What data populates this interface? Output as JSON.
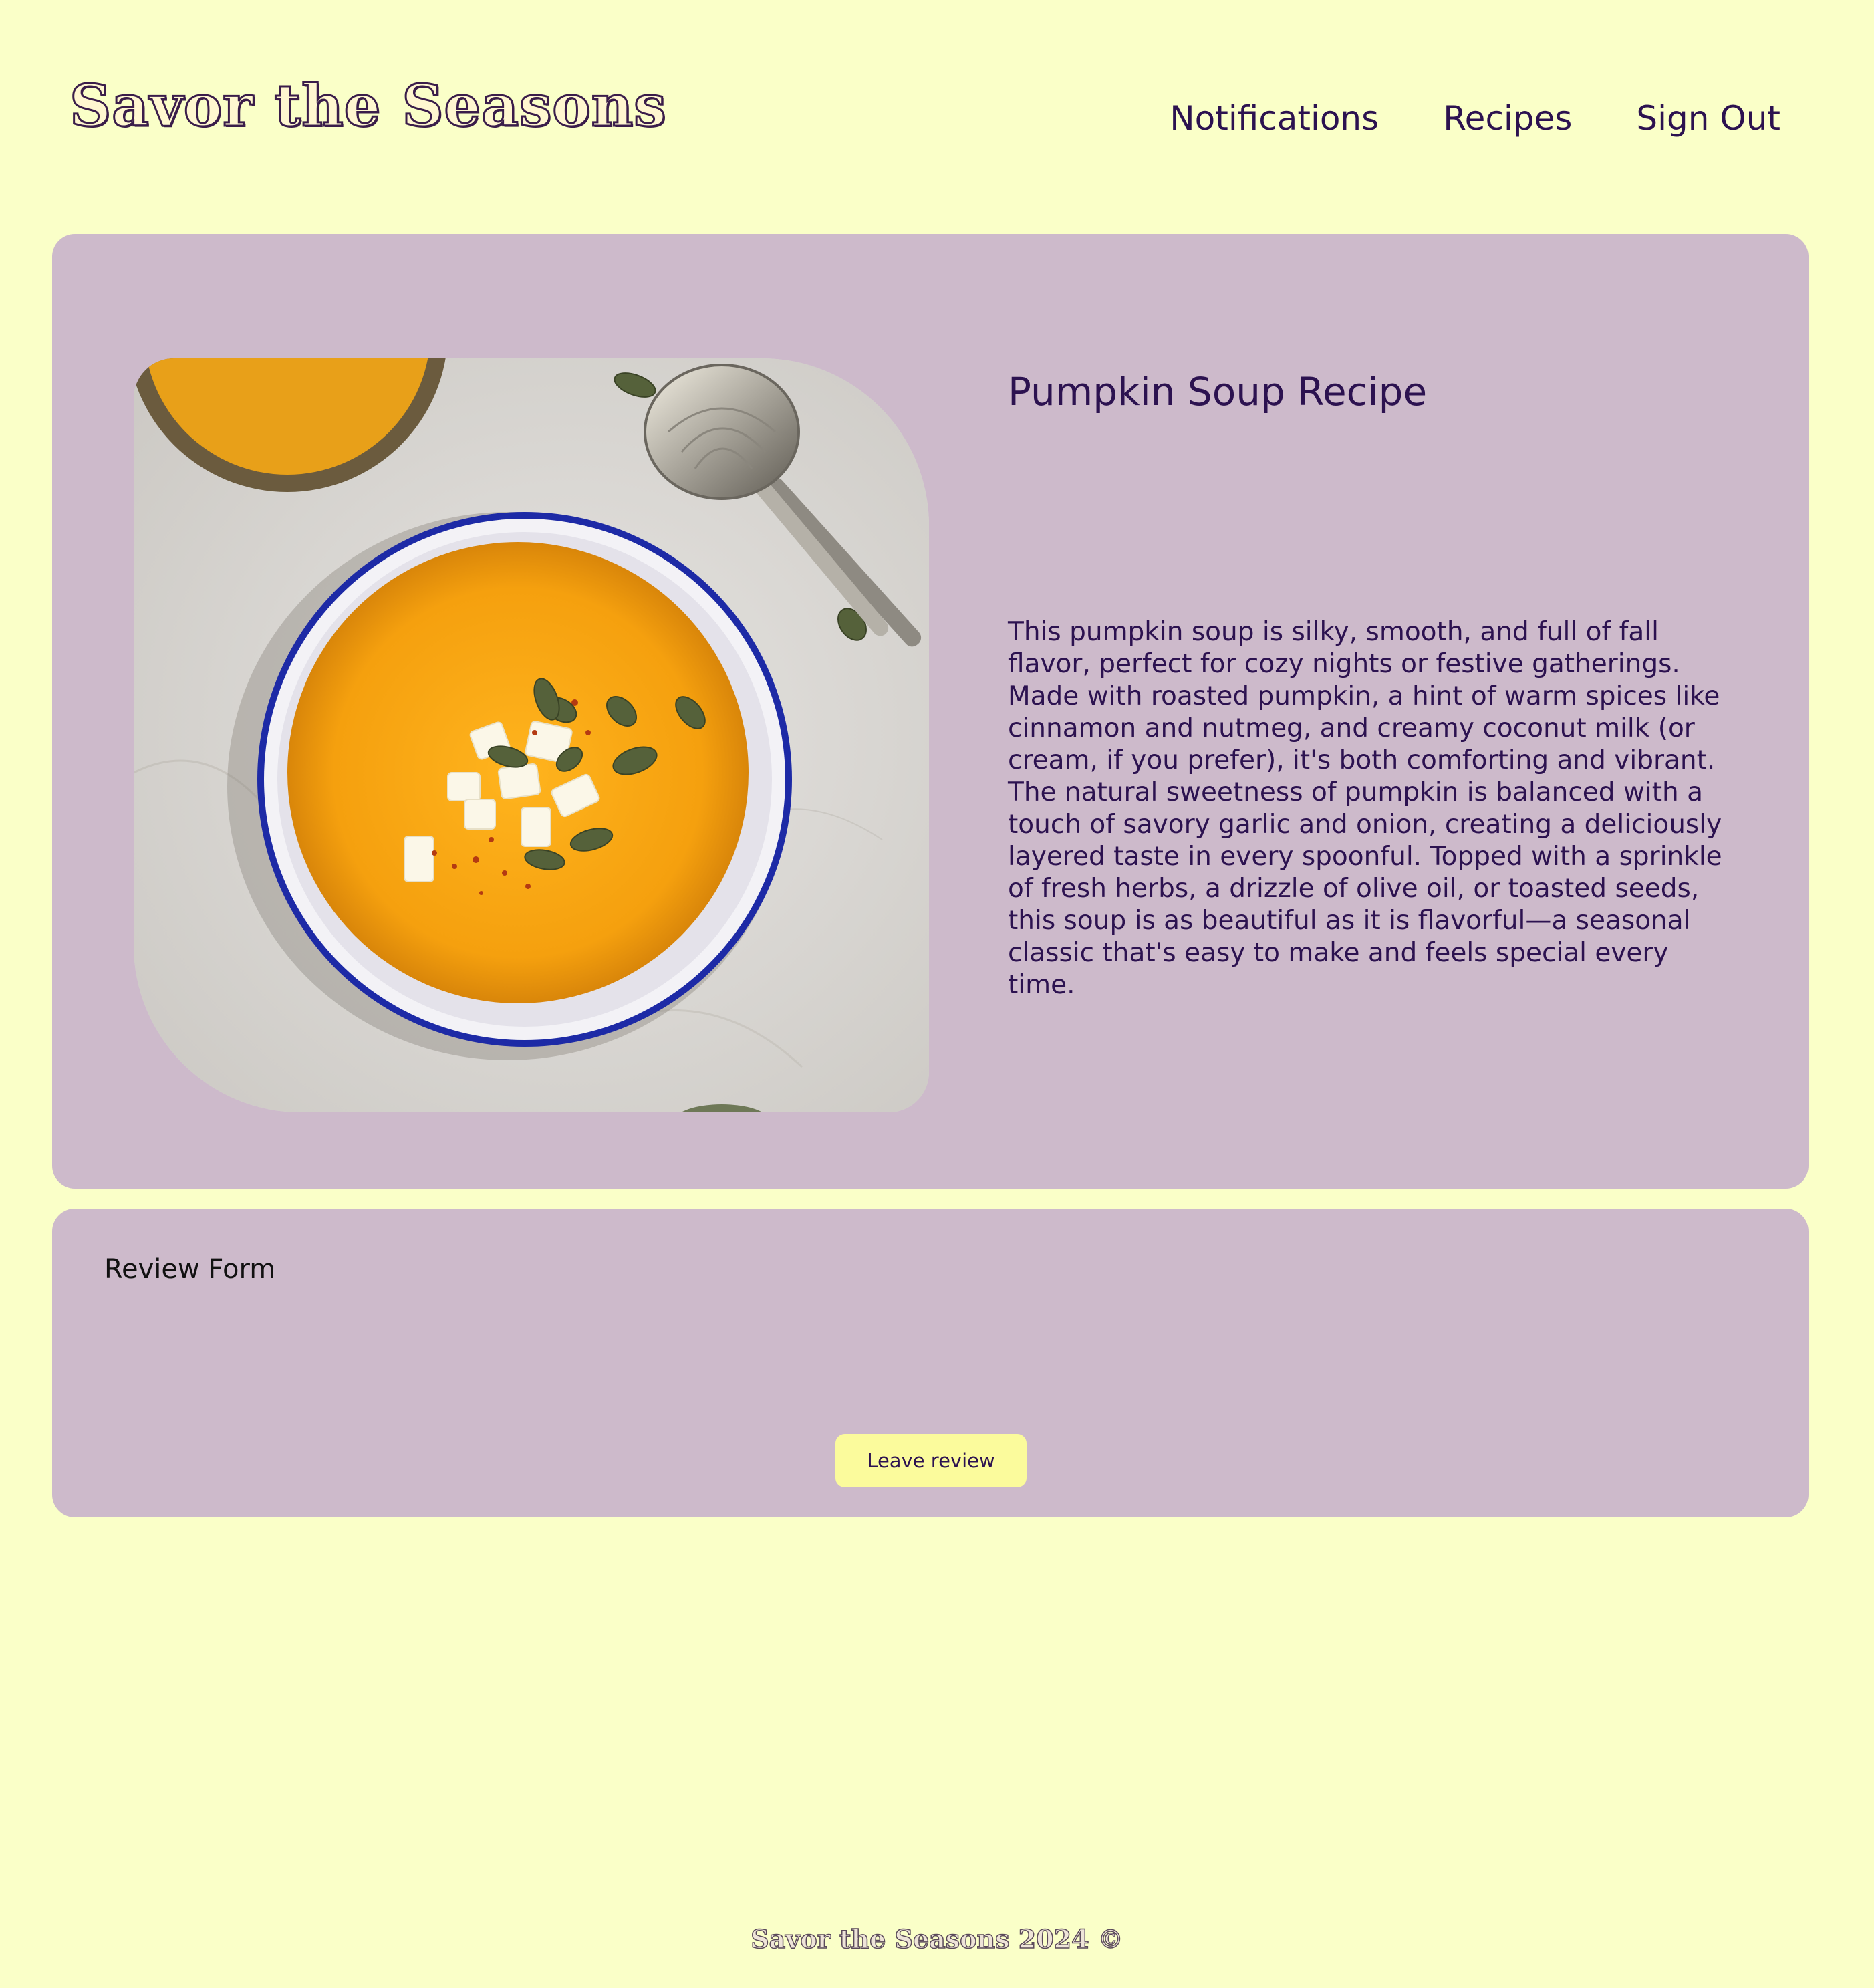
{
  "header": {
    "brand": "Savor the Seasons",
    "nav": [
      {
        "label": "Notifications"
      },
      {
        "label": "Recipes"
      },
      {
        "label": "Sign Out"
      }
    ]
  },
  "recipe": {
    "title": "Pumpkin Soup Recipe",
    "description": "This pumpkin soup is silky, smooth, and full of fall flavor, perfect for cozy nights or festive gatherings. Made with roasted pumpkin, a hint of warm spices like cinnamon and nutmeg, and creamy coconut milk (or cream, if you prefer), it's both comforting and vibrant. The natural sweetness of pumpkin is balanced with a touch of savory garlic and onion, creating a deliciously layered taste in every spoonful. Topped with a sprinkle of fresh herbs, a drizzle of olive oil, or toasted seeds, this soup is as beautiful as it is flavorful—a seasonal classic that's easy to make and feels special every time."
  },
  "review": {
    "title": "Review Form",
    "button_label": "Leave review"
  },
  "footer": {
    "text": "Savor the Seasons 2024 ©"
  },
  "colors": {
    "page_background": "#faffc8",
    "card_background": "#cdbacb",
    "text_primary": "#2c1250",
    "button_background": "#fbfb9c"
  }
}
